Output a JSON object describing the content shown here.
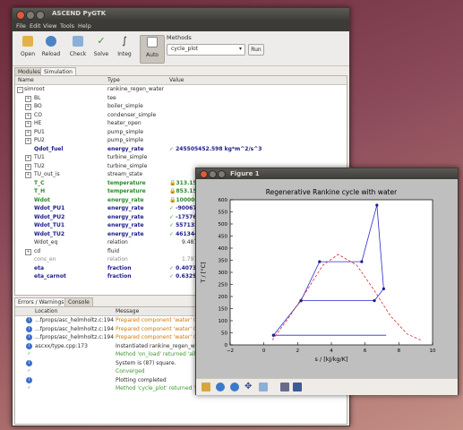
{
  "app": {
    "title": "ASCEND PyGTK",
    "menu": [
      "File",
      "Edit",
      "View",
      "Tools",
      "Help"
    ]
  },
  "toolbar": {
    "buttons": [
      {
        "label": "Open",
        "icon": "folder-open-icon"
      },
      {
        "label": "Reload",
        "icon": "reload-icon"
      },
      {
        "label": "Check",
        "icon": "check-icon"
      },
      {
        "label": "Solve",
        "icon": "solve-icon"
      },
      {
        "label": "Integ",
        "icon": "integrate-icon"
      },
      {
        "label": "Auto",
        "icon": "auto-icon"
      }
    ],
    "methods_label": "Methods",
    "method_selected": "cycle_plot",
    "run_label": "Run"
  },
  "tabs": [
    "Modules",
    "Simulation"
  ],
  "tree": {
    "headers": [
      "Name",
      "Type",
      "Value"
    ],
    "rows": [
      {
        "name": "simroot",
        "type": "rankine_regen_water",
        "value": ""
      },
      {
        "name": "BL",
        "type": "tee",
        "value": ""
      },
      {
        "name": "BO",
        "type": "boiler_simple",
        "value": ""
      },
      {
        "name": "CO",
        "type": "condenser_simple",
        "value": ""
      },
      {
        "name": "HE",
        "type": "heater_open",
        "value": ""
      },
      {
        "name": "PU1",
        "type": "pump_simple",
        "value": ""
      },
      {
        "name": "PU2",
        "type": "pump_simple",
        "value": ""
      },
      {
        "name": "Qdot_fuel",
        "type": "energy_rate",
        "value": "245505452.598 kg*m^2/s^3"
      },
      {
        "name": "TU1",
        "type": "turbine_simple",
        "value": ""
      },
      {
        "name": "TU2",
        "type": "turbine_simple",
        "value": ""
      },
      {
        "name": "TU_out_is",
        "type": "stream_state",
        "value": ""
      },
      {
        "name": "T_C",
        "type": "temperature",
        "value": "313.15"
      },
      {
        "name": "T_H",
        "type": "temperature",
        "value": "853.15"
      },
      {
        "name": "Wdot",
        "type": "energy_rate",
        "value": "100000"
      },
      {
        "name": "Wdot_PU1",
        "type": "energy_rate",
        "value": "-90067"
      },
      {
        "name": "Wdot_PU2",
        "type": "energy_rate",
        "value": "-17576"
      },
      {
        "name": "Wdot_TU1",
        "type": "energy_rate",
        "value": "557132"
      },
      {
        "name": "Wdot_TU2",
        "type": "energy_rate",
        "value": "461344"
      },
      {
        "name": "Wdot_eq",
        "type": "relation",
        "value": "9.48784"
      },
      {
        "name": "cd",
        "type": "fluid",
        "value": ""
      },
      {
        "name": "cons_en",
        "type": "relation",
        "value": "1.79769"
      },
      {
        "name": "eta",
        "type": "fraction",
        "value": "0.4073"
      },
      {
        "name": "eta_carnot",
        "type": "fraction",
        "value": "0.6329"
      }
    ]
  },
  "errors": {
    "tabs": [
      "Errors / Warnings",
      "Console"
    ],
    "headers": [
      "Location",
      "Message"
    ],
    "rows": [
      {
        "icon": "info",
        "location": "...fprops/asc_helmholtz.c:194",
        "message": "Prepared component 'water' OK."
      },
      {
        "icon": "info",
        "location": "...fprops/asc_helmholtz.c:194",
        "message": "Prepared component 'water' OK."
      },
      {
        "icon": "info",
        "location": "...fprops/asc_helmholtz.c:194",
        "message": "Prepared component 'water' OK."
      },
      {
        "icon": "info",
        "location": "ascxx/type.cpp:173",
        "message": "Instantiated rankine_regen_water"
      },
      {
        "icon": "ok",
        "location": "",
        "message": "Method 'on_load' returned 'all_ok'"
      },
      {
        "icon": "info",
        "location": "",
        "message": "System is (87) square."
      },
      {
        "icon": "ok",
        "location": "",
        "message": "Converged"
      },
      {
        "icon": "info",
        "location": "",
        "message": "Plotting completed"
      },
      {
        "icon": "ok",
        "location": "",
        "message": "Method 'cycle_plot' returned 'all_ok' and output no errors."
      }
    ]
  },
  "figure": {
    "window_title": "Figure 1",
    "tools": [
      "home-icon",
      "back-icon",
      "forward-icon",
      "pan-icon",
      "zoom-icon",
      "save-icon",
      "subplots-icon"
    ]
  },
  "chart_data": {
    "type": "line",
    "title": "Regenerative Rankine cycle with water",
    "xlabel": "s / [kJ/kg/K]",
    "ylabel": "T / [°C]",
    "xlim": [
      -2,
      10
    ],
    "ylim": [
      0,
      600
    ],
    "xticks": [
      -2,
      0,
      2,
      4,
      6,
      8,
      10
    ],
    "yticks": [
      0,
      50,
      100,
      150,
      200,
      250,
      300,
      350,
      400,
      450,
      500,
      550,
      600
    ],
    "series": [
      {
        "style": "blue-solid-markers",
        "x": [
          0.57,
          2.2,
          3.3,
          5.8,
          6.7,
          7.1,
          6.55,
          2.2,
          0.57
        ],
        "y": [
          40,
          183,
          344,
          344,
          578,
          232,
          183,
          183,
          40
        ]
      },
      {
        "style": "blue-solid",
        "x": [
          0.57,
          7.25
        ],
        "y": [
          40,
          40
        ]
      },
      {
        "style": "red-dashed-saturation",
        "x": [
          0.5,
          1.5,
          2.5,
          3.5,
          4.4,
          5.5,
          6.5,
          7.5,
          8.5,
          9.3
        ],
        "y": [
          20,
          115,
          220,
          330,
          374,
          330,
          230,
          120,
          45,
          20
        ]
      }
    ]
  }
}
